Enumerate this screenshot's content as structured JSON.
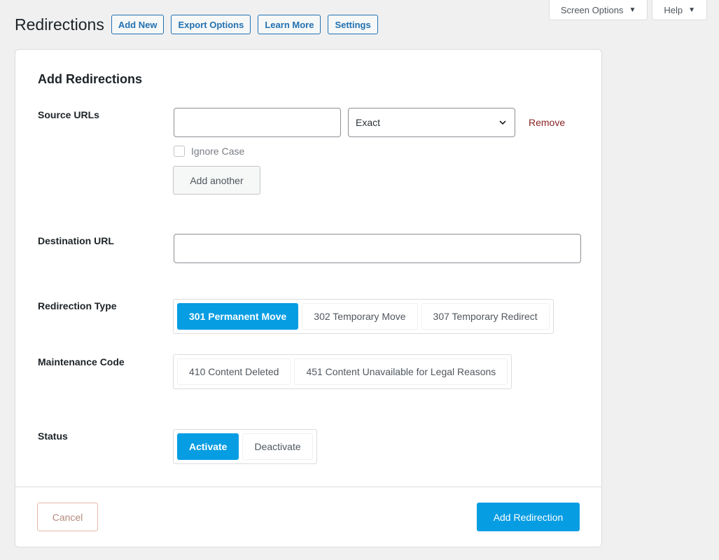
{
  "screen_meta": {
    "screen_options_label": "Screen Options",
    "help_label": "Help"
  },
  "header": {
    "title": "Redirections",
    "actions": {
      "add_new": "Add New",
      "export_options": "Export Options",
      "learn_more": "Learn More",
      "settings": "Settings"
    }
  },
  "form": {
    "title": "Add Redirections",
    "source_urls": {
      "label": "Source URLs",
      "url_value": "",
      "match_type": "Exact",
      "remove_label": "Remove",
      "ignore_case_label": "Ignore Case",
      "ignore_case_checked": false,
      "add_another_label": "Add another"
    },
    "destination": {
      "label": "Destination URL",
      "value": ""
    },
    "redirection_type": {
      "label": "Redirection Type",
      "options": [
        "301 Permanent Move",
        "302 Temporary Move",
        "307 Temporary Redirect"
      ],
      "selected": "301 Permanent Move"
    },
    "maintenance_code": {
      "label": "Maintenance Code",
      "options": [
        "410 Content Deleted",
        "451 Content Unavailable for Legal Reasons"
      ],
      "selected": ""
    },
    "status": {
      "label": "Status",
      "options": [
        "Activate",
        "Deactivate"
      ],
      "selected": "Activate"
    }
  },
  "footer": {
    "cancel_label": "Cancel",
    "submit_label": "Add Redirection"
  },
  "colors": {
    "accent": "#069de3",
    "link": "#2271b1",
    "remove": "#8a2424",
    "background": "#f0f0f1"
  },
  "icons": {
    "select_chevron": "chevron-down-icon",
    "meta_caret": "caret-down-icon"
  }
}
